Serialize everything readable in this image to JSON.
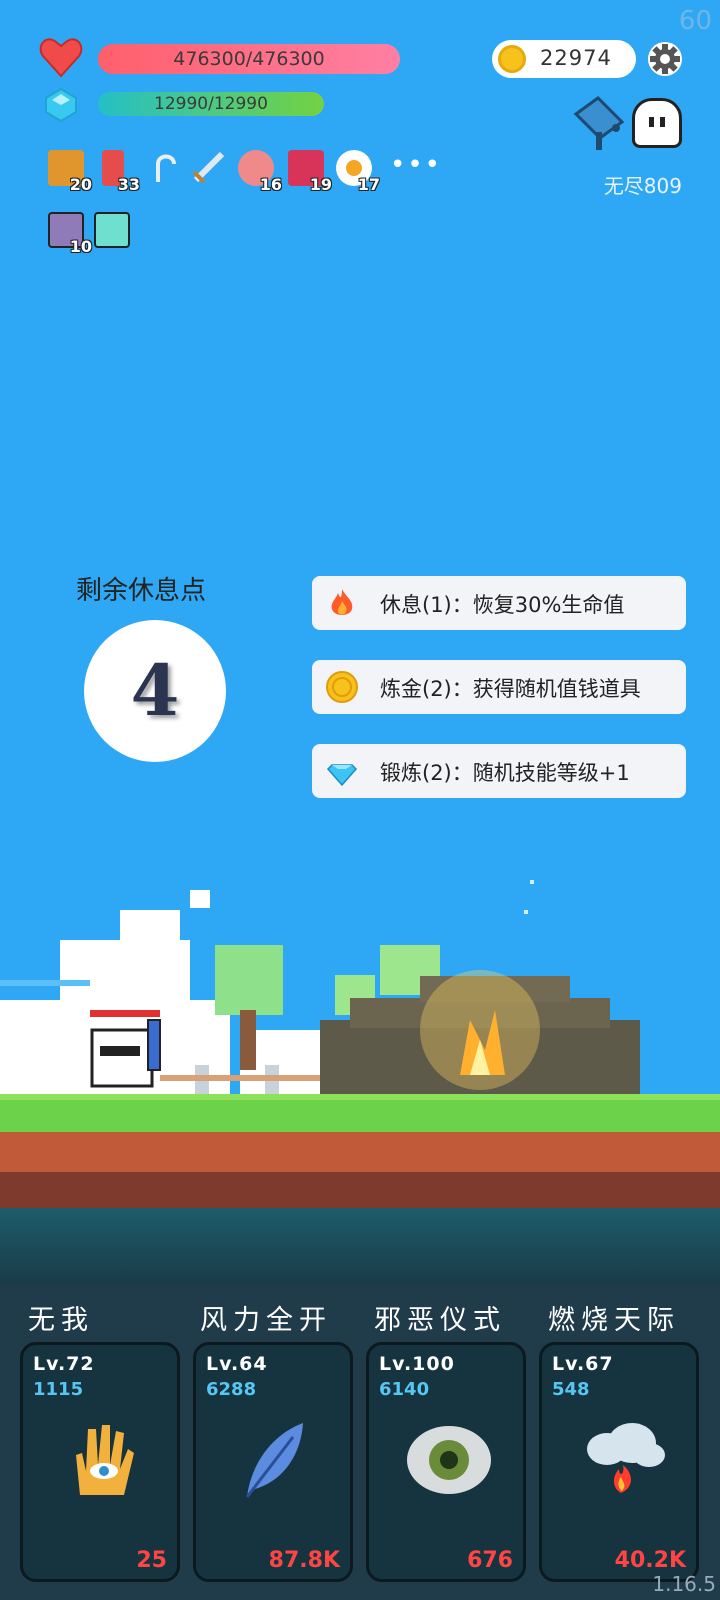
{
  "fps": "60",
  "version": "1.16.5",
  "player": {
    "hp_text": "476300/476300",
    "mp_text": "12990/12990",
    "hp_fraction": 1.0,
    "mp_fraction": 1.0
  },
  "currency": {
    "coins": "22974",
    "icon": "gold-coin-icon"
  },
  "mode_label": "无尽809",
  "inventory": [
    {
      "icon": "book-icon",
      "count": "20",
      "color": "#e0962c"
    },
    {
      "icon": "sock-icon",
      "count": "33",
      "color": "#e54c4c"
    },
    {
      "icon": "hook-icon",
      "count": "",
      "color": "#dfe6ee"
    },
    {
      "icon": "sword-icon",
      "count": "",
      "color": "#d0dbe6"
    },
    {
      "icon": "meat-icon",
      "count": "16",
      "color": "#f08a8a"
    },
    {
      "icon": "jam-jar-icon",
      "count": "19",
      "color": "#d8345a"
    },
    {
      "icon": "fried-egg-icon",
      "count": "17",
      "color": "#ffffff"
    },
    {
      "icon": "scroll-icon",
      "count": "10",
      "color": "#8f7bb8"
    },
    {
      "icon": "lightbulb-card-icon",
      "count": "",
      "color": "#6fe0d0"
    }
  ],
  "rest": {
    "title": "剩余休息点",
    "points": "4",
    "options": [
      {
        "icon": "fire-icon",
        "label": "休息(1)：恢复30%生命值"
      },
      {
        "icon": "gold-coin-icon",
        "label": "炼金(2)：获得随机值钱道具"
      },
      {
        "icon": "diamond-icon",
        "label": "锻炼(2)：随机技能等级+1"
      }
    ]
  },
  "skills": [
    {
      "name": "无我",
      "level": "Lv.72",
      "value": "1115",
      "cost": "25",
      "icon": "hand-eye-icon"
    },
    {
      "name": "风力全开",
      "level": "Lv.64",
      "value": "6288",
      "cost": "87.8K",
      "icon": "feather-icon"
    },
    {
      "name": "邪恶仪式",
      "level": "Lv.100",
      "value": "6140",
      "cost": "676",
      "icon": "eye-icon"
    },
    {
      "name": "燃烧天际",
      "level": "Lv.67",
      "value": "548",
      "cost": "40.2K",
      "icon": "cloud-fire-icon"
    }
  ]
}
